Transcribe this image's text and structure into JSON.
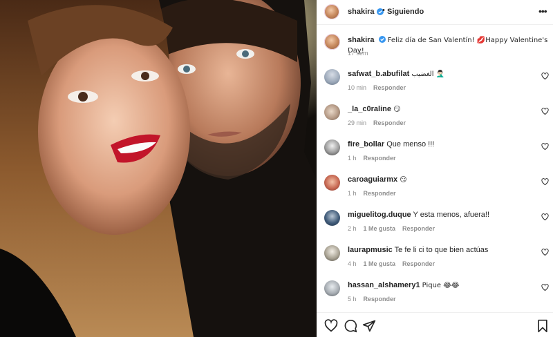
{
  "post": {
    "author": "shakira",
    "follow_separator": "•",
    "follow_status": "Siguiendo",
    "more_label": "•••",
    "caption_text": "Feliz día de San Valentín! 💋Happy Valentine's Day!",
    "caption_time": "17 sem"
  },
  "comments": [
    {
      "user": "safwat_b.abufilat",
      "text": "الغضيب 🤦🏻‍♂️",
      "time": "10 min",
      "likes": "",
      "reply": "Responder"
    },
    {
      "user": "_la_c0raline",
      "text": "😏",
      "time": "29 min",
      "likes": "",
      "reply": "Responder"
    },
    {
      "user": "fire_bollar",
      "text": "Que menso !!!",
      "time": "1 h",
      "likes": "",
      "reply": "Responder"
    },
    {
      "user": "caroaguiarmx",
      "text": "😏",
      "time": "1 h",
      "likes": "",
      "reply": "Responder"
    },
    {
      "user": "miguelitog.duque",
      "text": "Y esta menos, afuera!!",
      "time": "2 h",
      "likes": "1 Me gusta",
      "reply": "Responder"
    },
    {
      "user": "laurapmusic",
      "text": "Te fe li ci to que bien actúas",
      "time": "4 h",
      "likes": "1 Me gusta",
      "reply": "Responder"
    },
    {
      "user": "hassan_alshamery1",
      "text": "Pique 😂😂",
      "time": "5 h",
      "likes": "",
      "reply": "Responder"
    }
  ],
  "icons": {
    "verified": "verified-badge-icon",
    "like": "heart-icon",
    "comment": "comment-icon",
    "share": "paper-plane-icon",
    "save": "bookmark-icon"
  },
  "colors": {
    "accent": "#3897f0",
    "muted": "#8e8e8e",
    "text": "#262626"
  }
}
